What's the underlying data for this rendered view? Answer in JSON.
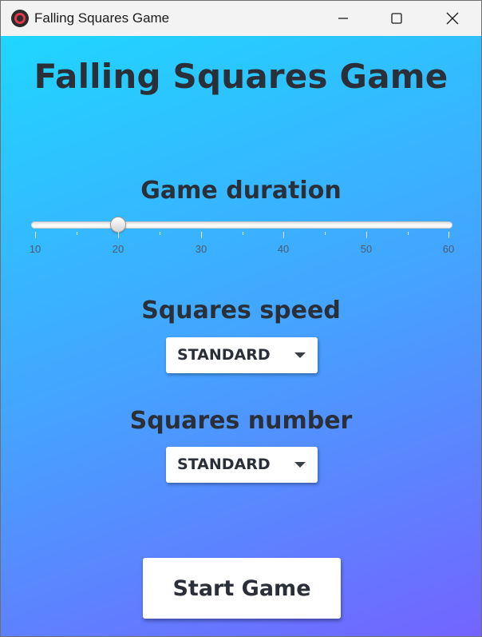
{
  "window": {
    "title": "Falling Squares Game",
    "icon": "record-circle-icon",
    "controls": {
      "minimize": "minimize-icon",
      "maximize": "maximize-icon",
      "close": "close-icon"
    }
  },
  "main": {
    "title": "Falling Squares Game",
    "duration": {
      "label": "Game duration",
      "value": 20,
      "min": 10,
      "max": 60,
      "tick_labels": [
        "10",
        "20",
        "30",
        "40",
        "50",
        "60"
      ]
    },
    "speed": {
      "label": "Squares speed",
      "selected": "STANDARD"
    },
    "number": {
      "label": "Squares number",
      "selected": "STANDARD"
    },
    "start_label": "Start Game"
  },
  "colors": {
    "gradient_start": "#1fd6ff",
    "gradient_end": "#7364ff",
    "text": "#2a2f38",
    "close_accent": "#e0394c"
  }
}
